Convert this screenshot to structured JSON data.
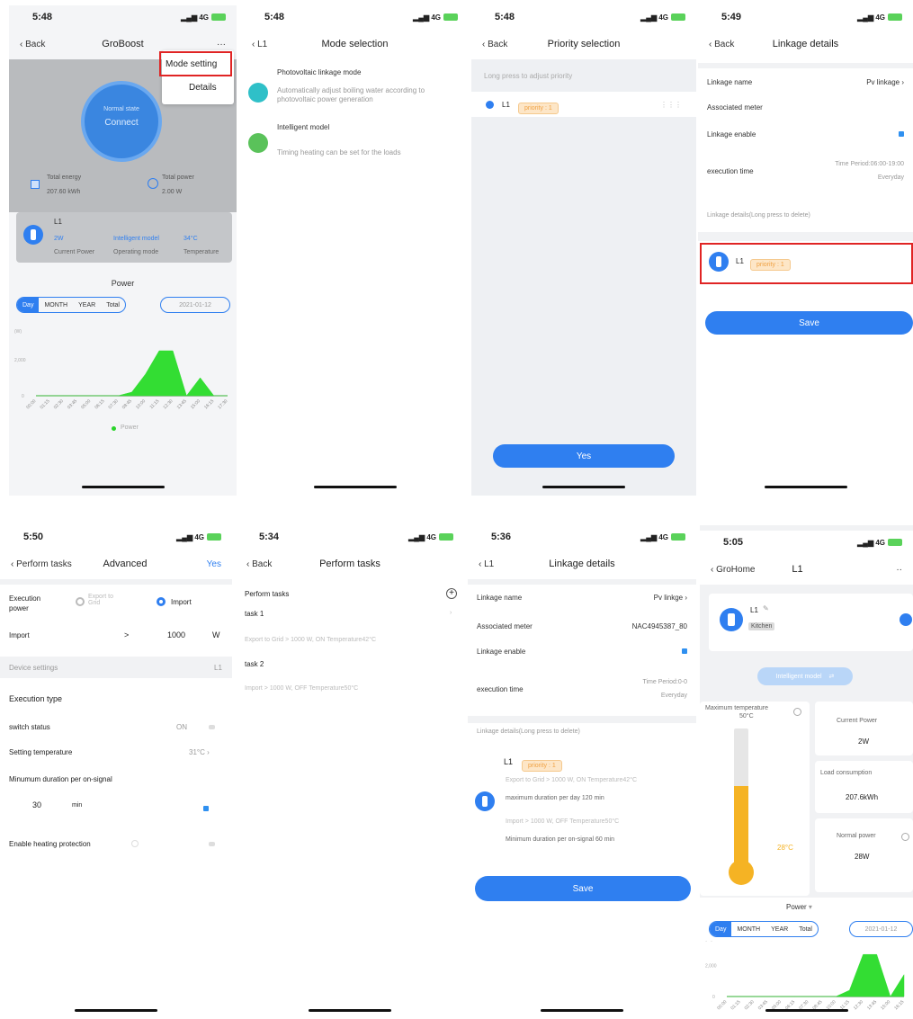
{
  "screens": {
    "s1": {
      "time": "5:48",
      "net": "4G",
      "back": "Back",
      "title": "GroBoost",
      "more": "···",
      "menu": [
        "Mode setting",
        "Details"
      ],
      "circle_top": "Normal state",
      "circle_main": "Connect",
      "total_energy_label": "Total energy",
      "total_energy": "207.60 kWh",
      "total_power_label": "Total power",
      "total_power": "2.00 W",
      "device": "L1",
      "stats": [
        {
          "value": "2W",
          "label": "Current Power"
        },
        {
          "value": "Intelligent model",
          "label": "Operating mode"
        },
        {
          "value": "34°C",
          "label": "Temperature"
        }
      ],
      "power_title": "Power",
      "seg": [
        "Day",
        "MONTH",
        "YEAR",
        "Total"
      ],
      "date": "2021-01-12",
      "y_unit": "(W)",
      "y_top": "2,000",
      "y_zero": "0",
      "legend": "Power",
      "x_ticks": [
        "00:00",
        "01:15",
        "02:30",
        "03:45",
        "05:00",
        "06:15",
        "07:30",
        "08:45",
        "10:00",
        "11:15",
        "12:30",
        "13:45",
        "15:00",
        "16:15",
        "17:30"
      ]
    },
    "s2": {
      "time": "5:48",
      "back": "L1",
      "title": "Mode selection",
      "modes": [
        {
          "title": "Photovoltaic linkage mode",
          "desc": "Automatically adjust boiling water according to photovoltaic power generation",
          "color": "#2fc0c8"
        },
        {
          "title": "Intelligent model",
          "desc": "Timing heating can be set for the loads",
          "color": "#5ac25a"
        }
      ]
    },
    "s3": {
      "time": "5:48",
      "back": "Back",
      "title": "Priority selection",
      "hint": "Long press to adjust priority",
      "device": "L1",
      "chip": "priority : 1",
      "drag": "⋮⋮⋮",
      "yes": "Yes"
    },
    "s4": {
      "time": "5:49",
      "back": "Back",
      "title": "Linkage details",
      "name_label": "Linkage name",
      "name_value": "Pv linkage",
      "meter_label": "Associated meter",
      "enable_label": "Linkage enable",
      "exec_label": "execution time",
      "exec_period": "Time Period:06:00-19:00",
      "exec_repeat": "Everyday",
      "details_label": "Linkage details(Long press to delete)",
      "device": "L1",
      "chip": "priority : 1",
      "save": "Save"
    },
    "s5": {
      "time": "5:50",
      "back": "Perform tasks",
      "title": "Advanced",
      "yes": "Yes",
      "exec_power_label": "Execution power",
      "opt_export": "Export to Grid",
      "opt_import": "Import",
      "import_label": "Import",
      "cmp": ">",
      "import_value": "1000",
      "unit_w": "W",
      "device_settings": "Device settings",
      "device": "L1",
      "exec_type": "Execution type",
      "switch_label": "switch status",
      "switch_value": "ON",
      "temp_label": "Setting temperature",
      "temp_value": "31°C",
      "min_label": "Minumum duration per on-signal",
      "min_value": "30",
      "min_unit": "min",
      "protect_label": "Enable heating protection"
    },
    "s6": {
      "time": "5:34",
      "back": "Back",
      "title": "Perform tasks",
      "header": "Perform tasks",
      "tasks": [
        {
          "name": "task 1",
          "desc": "Export to Grid > 1000 W,  ON Temperature42°C"
        },
        {
          "name": "task 2",
          "desc": "Import > 1000 W,  OFF Temperature50°C"
        }
      ]
    },
    "s7": {
      "time": "5:36",
      "back": "L1",
      "title": "Linkage details",
      "name_label": "Linkage name",
      "name_value": "Pv linkge",
      "meter_label": "Associated meter",
      "meter_value": "NAC4945387_80",
      "enable_label": "Linkage enable",
      "exec_label": "execution time",
      "exec_period": "Time Period:0-0",
      "exec_repeat": "Everyday",
      "details_label": "Linkage details(Long press to delete)",
      "device": "L1",
      "chip": "priority : 1",
      "lines": [
        "Export to Grid > 1000 W,  ON Temperature42°C",
        "maximum duration per day 120 min",
        "Import > 1000 W,  OFF Temperature50°C",
        "Minimum duration per on-signal 60 min"
      ],
      "save": "Save"
    },
    "s8": {
      "time": "5:05",
      "back": "GroHome",
      "title": "L1",
      "more": "··",
      "device": "L1",
      "room": "Kitchen",
      "mode_pill": "Intelligent model",
      "max_temp_label": "Maximum temperature",
      "max_temp": "50°C",
      "cur_temp": "28°C",
      "cur_power_label": "Current Power",
      "cur_power": "2W",
      "load_label": "Load consumption",
      "load_value": "207.6kWh",
      "normal_label": "Normal power",
      "normal_value": "28W",
      "power_title": "Power",
      "seg": [
        "Day",
        "MONTH",
        "YEAR",
        "Total"
      ],
      "date": "2021-01-12",
      "y_unit": "(W)",
      "y_top": "2,000",
      "y_zero": "0",
      "x_ticks": [
        "00:00",
        "01:15",
        "02:30",
        "03:45",
        "05:00",
        "06:15",
        "07:30",
        "08:45",
        "10:00",
        "11:15",
        "12:30",
        "13:45",
        "15:00",
        "16:15"
      ]
    }
  },
  "chart_data": [
    {
      "type": "area",
      "x": [
        "00:00",
        "01:15",
        "02:30",
        "03:45",
        "05:00",
        "06:15",
        "07:30",
        "08:45",
        "10:00",
        "11:15",
        "12:30",
        "13:45",
        "15:00",
        "16:15",
        "17:30"
      ],
      "series": [
        {
          "name": "Power",
          "values": [
            0,
            0,
            0,
            0,
            0,
            0,
            0,
            200,
            1200,
            2500,
            2500,
            0,
            1000,
            0,
            0
          ]
        }
      ],
      "ylim": [
        0,
        3000
      ],
      "color": "#33dd33"
    },
    {
      "type": "area",
      "x": [
        "00:00",
        "01:15",
        "02:30",
        "03:45",
        "05:00",
        "06:15",
        "07:30",
        "08:45",
        "10:00",
        "11:15",
        "12:30",
        "13:45",
        "15:00",
        "16:15"
      ],
      "series": [
        {
          "values": [
            0,
            0,
            0,
            0,
            0,
            0,
            0,
            0,
            0,
            400,
            2700,
            2700,
            0,
            1400
          ]
        }
      ],
      "ylim": [
        0,
        3000
      ],
      "color": "#33dd33"
    }
  ]
}
